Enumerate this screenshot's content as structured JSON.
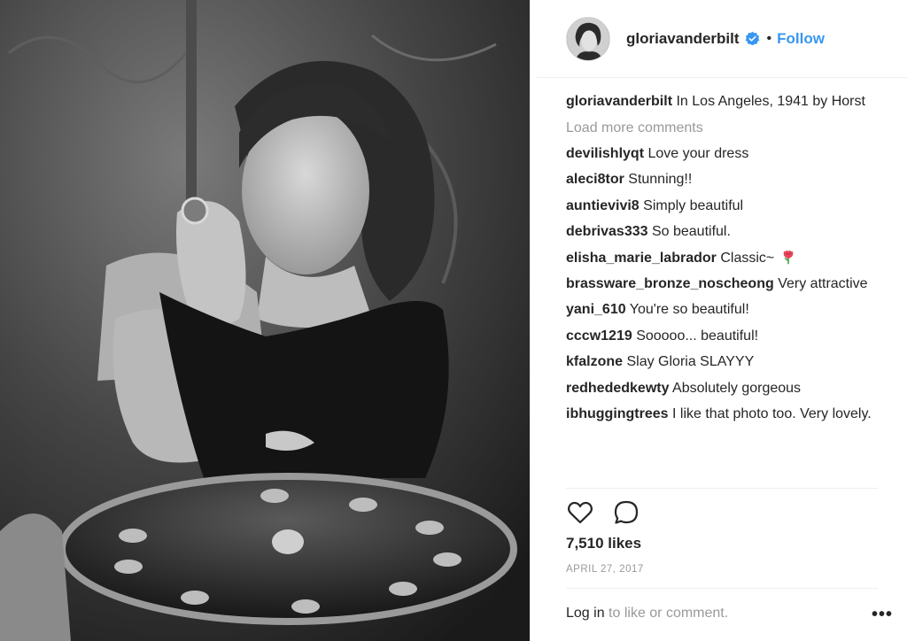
{
  "post": {
    "owner": "gloriavanderbilt",
    "follow_label": "Follow",
    "separator": "•",
    "caption": {
      "user": "gloriavanderbilt",
      "text": "In Los Angeles, 1941 by Horst"
    },
    "load_more": "Load more comments",
    "comments": [
      {
        "user": "devilishlyqt",
        "text": "Love your dress"
      },
      {
        "user": "aleci8tor",
        "text": "Stunning!!"
      },
      {
        "user": "auntievivi8",
        "text": "Simply beautiful"
      },
      {
        "user": "debrivas333",
        "text": "So beautiful."
      },
      {
        "user": "elisha_marie_labrador",
        "text": "Classic~",
        "emoji": "rose-icon"
      },
      {
        "user": "brassware_bronze_noscheong",
        "text": "Very attractive"
      },
      {
        "user": "yani_610",
        "text": "You're so beautiful!"
      },
      {
        "user": "cccw1219",
        "text": "Sooooo... beautiful!"
      },
      {
        "user": "kfalzone",
        "text": "Slay Gloria SLAYYY"
      },
      {
        "user": "redhededkewty",
        "text": "Absolutely gorgeous"
      },
      {
        "user": "ibhuggingtrees",
        "text": "I like that photo too. Very lovely."
      }
    ],
    "likes": "7,510 likes",
    "date": "APRIL 27, 2017",
    "login_link": "Log in",
    "login_rest": " to like or comment.",
    "more_label": "•••"
  },
  "icons": {
    "verified": "verified-badge-icon",
    "like": "heart-icon",
    "comment": "comment-bubble-icon",
    "more": "more-options-icon"
  },
  "colors": {
    "accent": "#3897f0",
    "text": "#262626",
    "muted": "#999999",
    "border": "#efefef"
  }
}
